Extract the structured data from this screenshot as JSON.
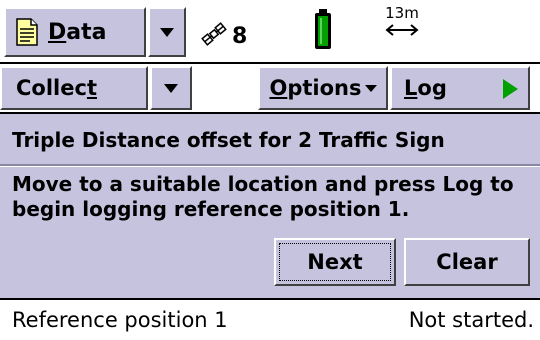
{
  "topbar": {
    "data_label_first": "D",
    "data_label_rest": "ata",
    "satellite_count": "8",
    "precision": "13m"
  },
  "toolbar": {
    "collect_label_pre": "Collec",
    "collect_label_ul": "t",
    "options_label_ul": "O",
    "options_label_rest": "ptions",
    "log_label_ul": "L",
    "log_label_rest": "og"
  },
  "panel": {
    "title": "Triple Distance offset for 2 Traffic Sign",
    "message": "Move to a suitable location and press Log to begin logging reference position 1.",
    "next_label": "Next",
    "clear_label": "Clear"
  },
  "status": {
    "label": "Reference position 1",
    "value": "Not started."
  },
  "icons": {
    "document": "document-icon",
    "satellite": "satellite-icon",
    "battery": "battery-icon",
    "precision_arrow": "double-arrow-icon",
    "play": "play-icon"
  },
  "colors": {
    "panel_bg": "#c6c3de",
    "play_green": "#00a000",
    "battery_green": "#00a000"
  }
}
